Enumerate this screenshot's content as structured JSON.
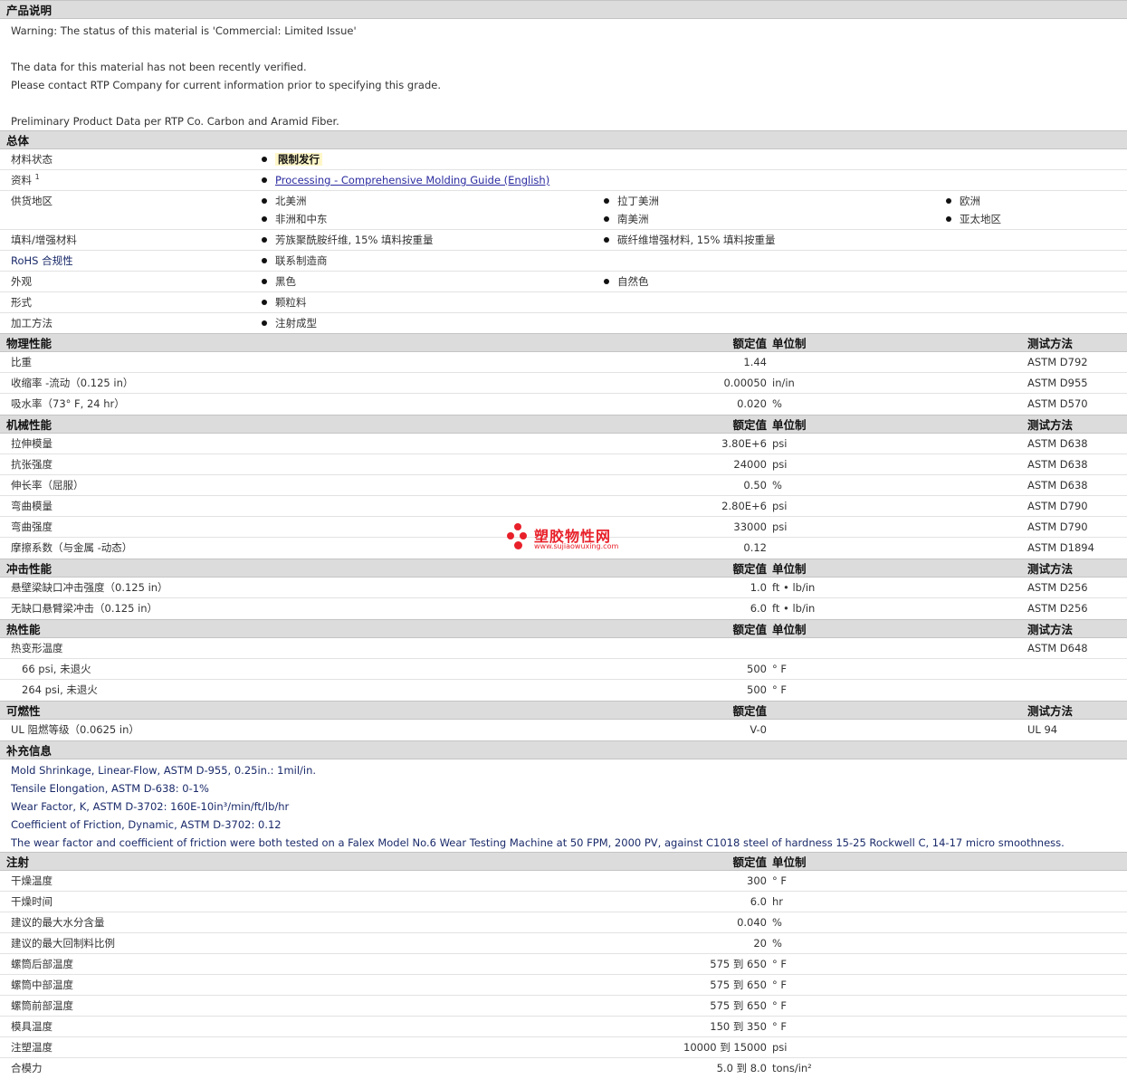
{
  "product_description": {
    "title": "产品说明",
    "lines": [
      "Warning: The status of this material is 'Commercial: Limited Issue'",
      "",
      "The data for this material has not been recently verified.",
      "Please contact RTP Company for current information prior to specifying this grade.",
      "",
      "Preliminary Product Data per RTP Co. Carbon and Aramid Fiber."
    ]
  },
  "general": {
    "title": "总体",
    "rows": {
      "status": {
        "label": "材料状态",
        "value": "限制发行"
      },
      "docs": {
        "label": "资料",
        "sup": "1",
        "link": "Processing - Comprehensive Molding Guide (English)"
      },
      "regions": {
        "label": "供货地区",
        "items": [
          "北美洲",
          "拉丁美洲",
          "欧洲",
          "非洲和中东",
          "南美洲",
          "亚太地区"
        ]
      },
      "filler": {
        "label": "填料/增强材料",
        "items": [
          "芳族聚酰胺纤维, 15% 填料按重量",
          "碳纤维增强材料, 15% 填料按重量"
        ]
      },
      "rohs": {
        "label": "RoHS 合规性",
        "items": [
          "联系制造商"
        ]
      },
      "appearance": {
        "label": "外观",
        "items": [
          "黑色",
          "自然色"
        ]
      },
      "form": {
        "label": "形式",
        "items": [
          "颗粒料"
        ]
      },
      "processing": {
        "label": "加工方法",
        "items": [
          "注射成型"
        ]
      }
    }
  },
  "headers": {
    "value": "额定值",
    "unit": "单位制",
    "test": "测试方法"
  },
  "physical": {
    "title": "物理性能",
    "rows": [
      {
        "label": "比重",
        "value": "1.44",
        "unit": "",
        "test": "ASTM D792"
      },
      {
        "label": "收缩率 -流动（0.125 in）",
        "value": "0.00050",
        "unit": "in/in",
        "test": "ASTM D955"
      },
      {
        "label": "吸水率（73° F, 24 hr）",
        "value": "0.020",
        "unit": "%",
        "test": "ASTM D570"
      }
    ]
  },
  "mechanical": {
    "title": "机械性能",
    "rows": [
      {
        "label": "拉伸模量",
        "value": "3.80E+6",
        "unit": "psi",
        "test": "ASTM D638"
      },
      {
        "label": "抗张强度",
        "value": "24000",
        "unit": "psi",
        "test": "ASTM D638"
      },
      {
        "label": "伸长率（屈服）",
        "value": "0.50",
        "unit": "%",
        "test": "ASTM D638"
      },
      {
        "label": "弯曲模量",
        "value": "2.80E+6",
        "unit": "psi",
        "test": "ASTM D790"
      },
      {
        "label": "弯曲强度",
        "value": "33000",
        "unit": "psi",
        "test": "ASTM D790"
      },
      {
        "label": "摩擦系数（与金属 -动态）",
        "value": "0.12",
        "unit": "",
        "test": "ASTM D1894"
      }
    ]
  },
  "impact": {
    "title": "冲击性能",
    "rows": [
      {
        "label": "悬壁梁缺口冲击强度（0.125 in）",
        "value": "1.0",
        "unit": "ft • lb/in",
        "test": "ASTM D256"
      },
      {
        "label": "无缺口悬臂梁冲击（0.125 in）",
        "value": "6.0",
        "unit": "ft • lb/in",
        "test": "ASTM D256"
      }
    ]
  },
  "thermal": {
    "title": "热性能",
    "rows": [
      {
        "label": "热变形温度",
        "value": "",
        "unit": "",
        "test": "ASTM D648"
      },
      {
        "label": "66 psi, 未退火",
        "value": "500",
        "unit": "° F",
        "test": ""
      },
      {
        "label": "264 psi, 未退火",
        "value": "500",
        "unit": "° F",
        "test": ""
      }
    ]
  },
  "flammability": {
    "title": "可燃性",
    "rows": [
      {
        "label": "UL 阻燃等级（0.0625 in）",
        "value": "V-0",
        "unit": "",
        "test": "UL 94"
      }
    ]
  },
  "supplementary": {
    "title": "补充信息",
    "lines": [
      "Mold Shrinkage, Linear-Flow, ASTM D-955, 0.25in.: 1mil/in.",
      "Tensile Elongation, ASTM D-638: 0-1%",
      "Wear Factor, K, ASTM D-3702: 160E-10in³/min/ft/lb/hr",
      "Coefficient of Friction, Dynamic, ASTM D-3702: 0.12",
      "The wear factor and coefficient of friction were both tested on a Falex Model No.6 Wear Testing Machine at 50 FPM, 2000 PV, against C1018 steel of hardness 15-25 Rockwell C, 14-17 micro smoothness."
    ]
  },
  "injection": {
    "title": "注射",
    "rows": [
      {
        "label": "干燥温度",
        "value": "300",
        "unit": "° F"
      },
      {
        "label": "干燥时间",
        "value": "6.0",
        "unit": "hr"
      },
      {
        "label": "建议的最大水分含量",
        "value": "0.040",
        "unit": "%"
      },
      {
        "label": "建议的最大回制料比例",
        "value": "20",
        "unit": "%"
      },
      {
        "label": "螺筒后部温度",
        "value": "575 到  650",
        "unit": "° F"
      },
      {
        "label": "螺筒中部温度",
        "value": "575 到  650",
        "unit": "° F"
      },
      {
        "label": "螺筒前部温度",
        "value": "575 到  650",
        "unit": "° F"
      },
      {
        "label": "模具温度",
        "value": "150 到  350",
        "unit": "° F"
      },
      {
        "label": "注塑温度",
        "value": "10000 到  15000",
        "unit": "psi"
      },
      {
        "label": "合模力",
        "value": "5.0 到  8.0",
        "unit": "tons/in²"
      }
    ]
  },
  "watermark": {
    "name": "塑胶物性网",
    "url": "www.sujiaowuxing.com",
    "color": "#e8202a"
  }
}
